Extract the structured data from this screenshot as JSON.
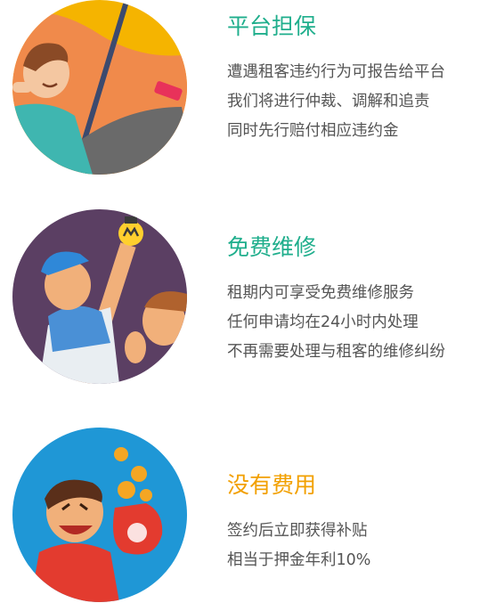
{
  "features": [
    {
      "title": "平台担保",
      "title_color": "#1fae8c",
      "icon": "umbrella-guarantee-illustration",
      "lines": [
        "遭遇租客违约行为可报告给平台",
        "我们将进行仲裁、调解和追责",
        "同时先行赔付相应违约金"
      ]
    },
    {
      "title": "免费维修",
      "title_color": "#1fae8c",
      "icon": "repairman-lightbulb-illustration",
      "lines": [
        "租期内可享受免费维修服务",
        "任何申请均在24小时内处理",
        "不再需要处理与租客的维修纠纷"
      ]
    },
    {
      "title": "没有费用",
      "title_color": "#f2a000",
      "icon": "money-bag-coins-illustration",
      "lines": [
        "签约后立即获得补贴",
        "相当于押金年利10%"
      ]
    }
  ]
}
